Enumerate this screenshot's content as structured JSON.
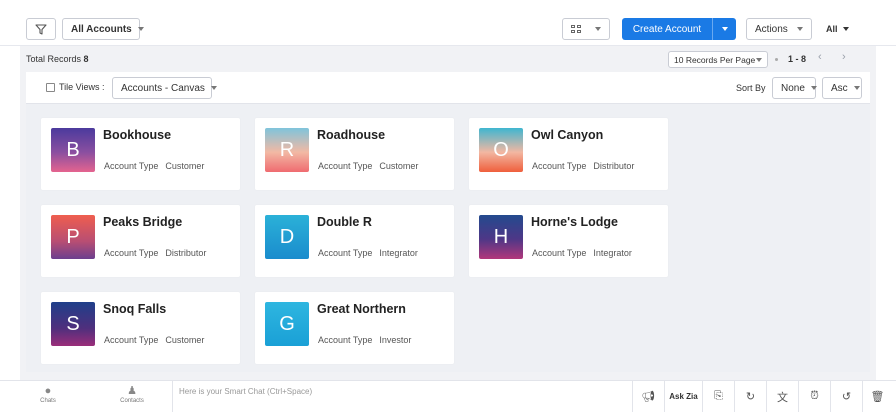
{
  "toolbar": {
    "account_filter": "All Accounts",
    "create_button": "Create Account",
    "actions_button": "Actions",
    "all_dropdown": "All"
  },
  "records": {
    "total_label": "Total Records",
    "total_count": "8",
    "per_page": "10 Records Per Page",
    "range": "1 - 8",
    "prev": "‹",
    "next": "›"
  },
  "tilebar": {
    "tile_views_label": "Tile Views :",
    "canvas_select": "Accounts - Canvas",
    "sort_by_label": "Sort By",
    "sort_field": "None",
    "sort_order": "Asc"
  },
  "cards": [
    {
      "initial": "B",
      "name": "Bookhouse",
      "type_label": "Account Type",
      "type": "Customer"
    },
    {
      "initial": "R",
      "name": "Roadhouse",
      "type_label": "Account Type",
      "type": "Customer"
    },
    {
      "initial": "O",
      "name": "Owl Canyon",
      "type_label": "Account Type",
      "type": "Distributor"
    },
    {
      "initial": "P",
      "name": "Peaks Bridge",
      "type_label": "Account Type",
      "type": "Distributor"
    },
    {
      "initial": "D",
      "name": "Double R",
      "type_label": "Account Type",
      "type": "Integrator"
    },
    {
      "initial": "H",
      "name": "Horne's Lodge",
      "type_label": "Account Type",
      "type": "Integrator"
    },
    {
      "initial": "S",
      "name": "Snoq Falls",
      "type_label": "Account Type",
      "type": "Customer"
    },
    {
      "initial": "G",
      "name": "Great Northern",
      "type_label": "Account Type",
      "type": "Investor"
    }
  ],
  "bottombar": {
    "chats": "Chats",
    "contacts": "Contacts",
    "smart_chat_placeholder": "Here is your Smart Chat (Ctrl+Space)",
    "ask_zia": "Ask Zia"
  },
  "colors": {
    "primary": "#1a7ae5",
    "background": "#f1f2f5"
  }
}
